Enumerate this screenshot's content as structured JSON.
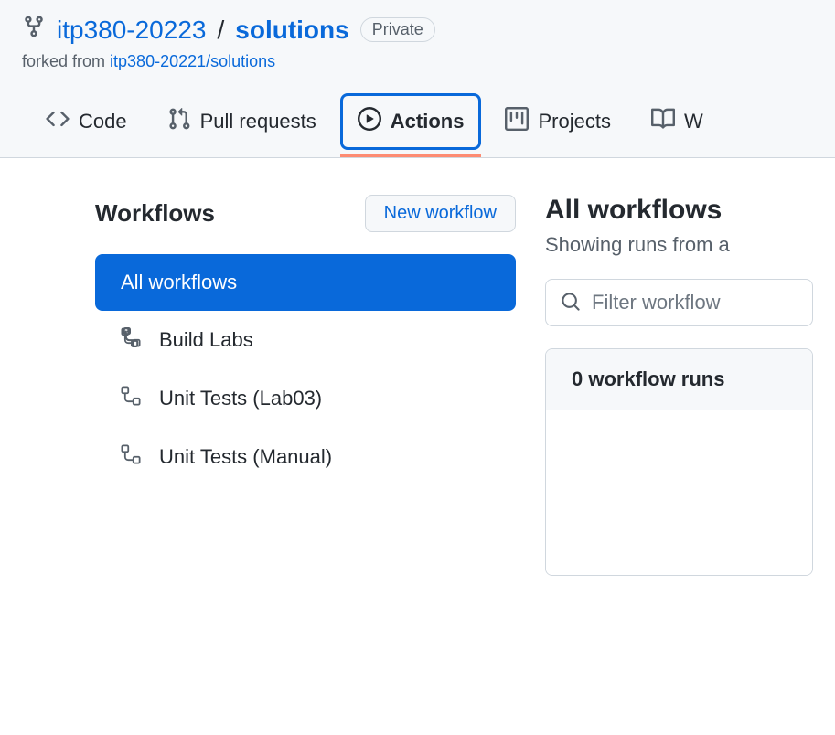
{
  "header": {
    "owner": "itp380-20223",
    "repo": "solutions",
    "visibility": "Private",
    "forked_from_label": "forked from ",
    "forked_from_repo": "itp380-20221/solutions"
  },
  "tabs": {
    "code": "Code",
    "pull_requests": "Pull requests",
    "actions": "Actions",
    "projects": "Projects",
    "wiki": "W"
  },
  "sidebar": {
    "title": "Workflows",
    "new_workflow": "New workflow",
    "items": [
      {
        "label": "All workflows",
        "selected": true
      },
      {
        "label": "Build Labs",
        "selected": false
      },
      {
        "label": "Unit Tests (Lab03)",
        "selected": false
      },
      {
        "label": "Unit Tests (Manual)",
        "selected": false
      }
    ]
  },
  "main": {
    "title": "All workflows",
    "subtitle": "Showing runs from a",
    "search_placeholder": "Filter workflow",
    "runs_header": "0 workflow runs"
  }
}
